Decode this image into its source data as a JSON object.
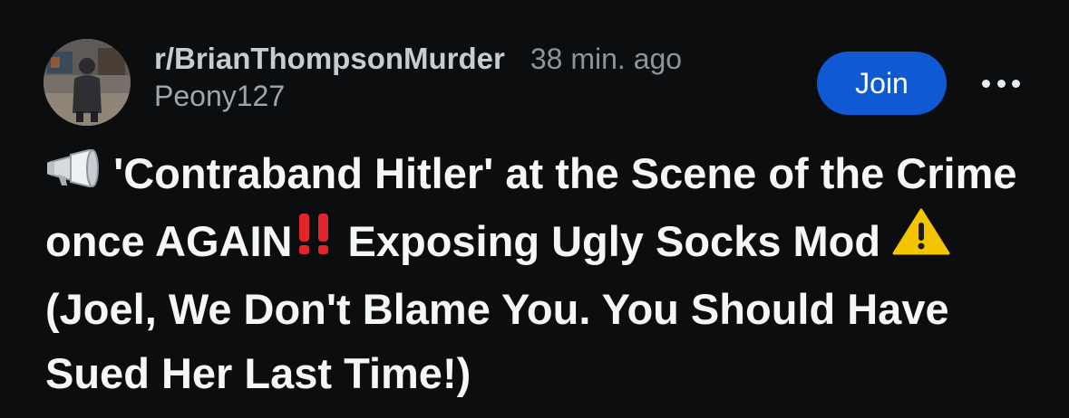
{
  "post": {
    "subreddit": "r/BrianThompsonMurder",
    "timestamp": "38 min. ago",
    "author": "Peony127",
    "join_label": "Join",
    "more_label": "More options",
    "title": {
      "part1": "'Contraband Hitler' at the Scene of the Crime once AGAIN",
      "part2": " Exposing Ugly Socks Mod ",
      "part3": " (Joel, We Don't Blame You. You Should Have Sued Her Last Time!)"
    },
    "icons": {
      "leading": "megaphone-icon",
      "exclamation": "double-exclamation-icon",
      "warning": "warning-icon"
    }
  },
  "colors": {
    "background": "#0b0d0f",
    "join_button": "#0f5ad3",
    "title_text": "#f4f6f7",
    "meta_text": "#8d959c",
    "exclamation": "#e0262a",
    "warning": "#f5c400"
  }
}
